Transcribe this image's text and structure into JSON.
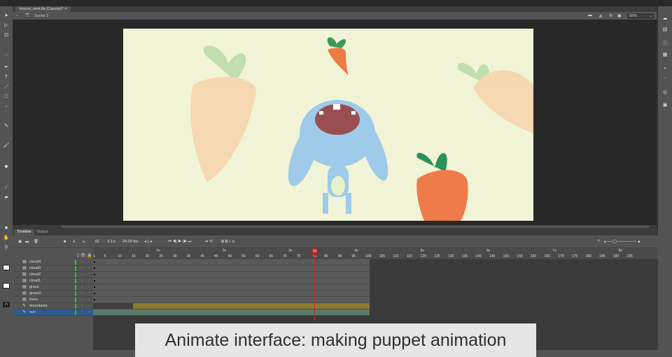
{
  "document_tab": {
    "title": "lesson_next.fla (Canvas)*",
    "close": "×"
  },
  "scene": {
    "label": "Scene 1"
  },
  "zoom": {
    "value": "65%"
  },
  "timeline": {
    "tabs": [
      "Timeline",
      "Output"
    ],
    "current_frame": "81",
    "elapsed": "3.3 s",
    "fps": "24.00 fps",
    "seconds": [
      "1s",
      "2s",
      "3s",
      "4s",
      "5s",
      "6s",
      "7s",
      "8s"
    ],
    "ticks": [
      "1",
      "5",
      "10",
      "15",
      "20",
      "25",
      "30",
      "35",
      "40",
      "45",
      "50",
      "55",
      "60",
      "65",
      "70",
      "75",
      "81",
      "85",
      "90",
      "95",
      "100",
      "105",
      "110",
      "115",
      "120",
      "125",
      "130",
      "135",
      "140",
      "145",
      "150",
      "155",
      "160",
      "165",
      "170",
      "175",
      "180",
      "185",
      "190",
      "195"
    ],
    "layers": [
      {
        "name": "cloud4",
        "type": "layer"
      },
      {
        "name": "cloud3",
        "type": "layer"
      },
      {
        "name": "cloud2",
        "type": "layer"
      },
      {
        "name": "cloud1",
        "type": "layer"
      },
      {
        "name": "grass",
        "type": "layer"
      },
      {
        "name": "grass2",
        "type": "layer"
      },
      {
        "name": "trees",
        "type": "layer"
      },
      {
        "name": "mountains",
        "type": "motion"
      },
      {
        "name": "sun",
        "type": "motion",
        "selected": true
      }
    ],
    "playhead_frame": 81,
    "last_frame": 100
  },
  "caption": "Animate interface: making puppet animation",
  "colors": {
    "canvas": "#f1f4d6",
    "tween": "#8c7a2e",
    "selected": "#2f5a8e",
    "playhead": "#c8282d"
  }
}
